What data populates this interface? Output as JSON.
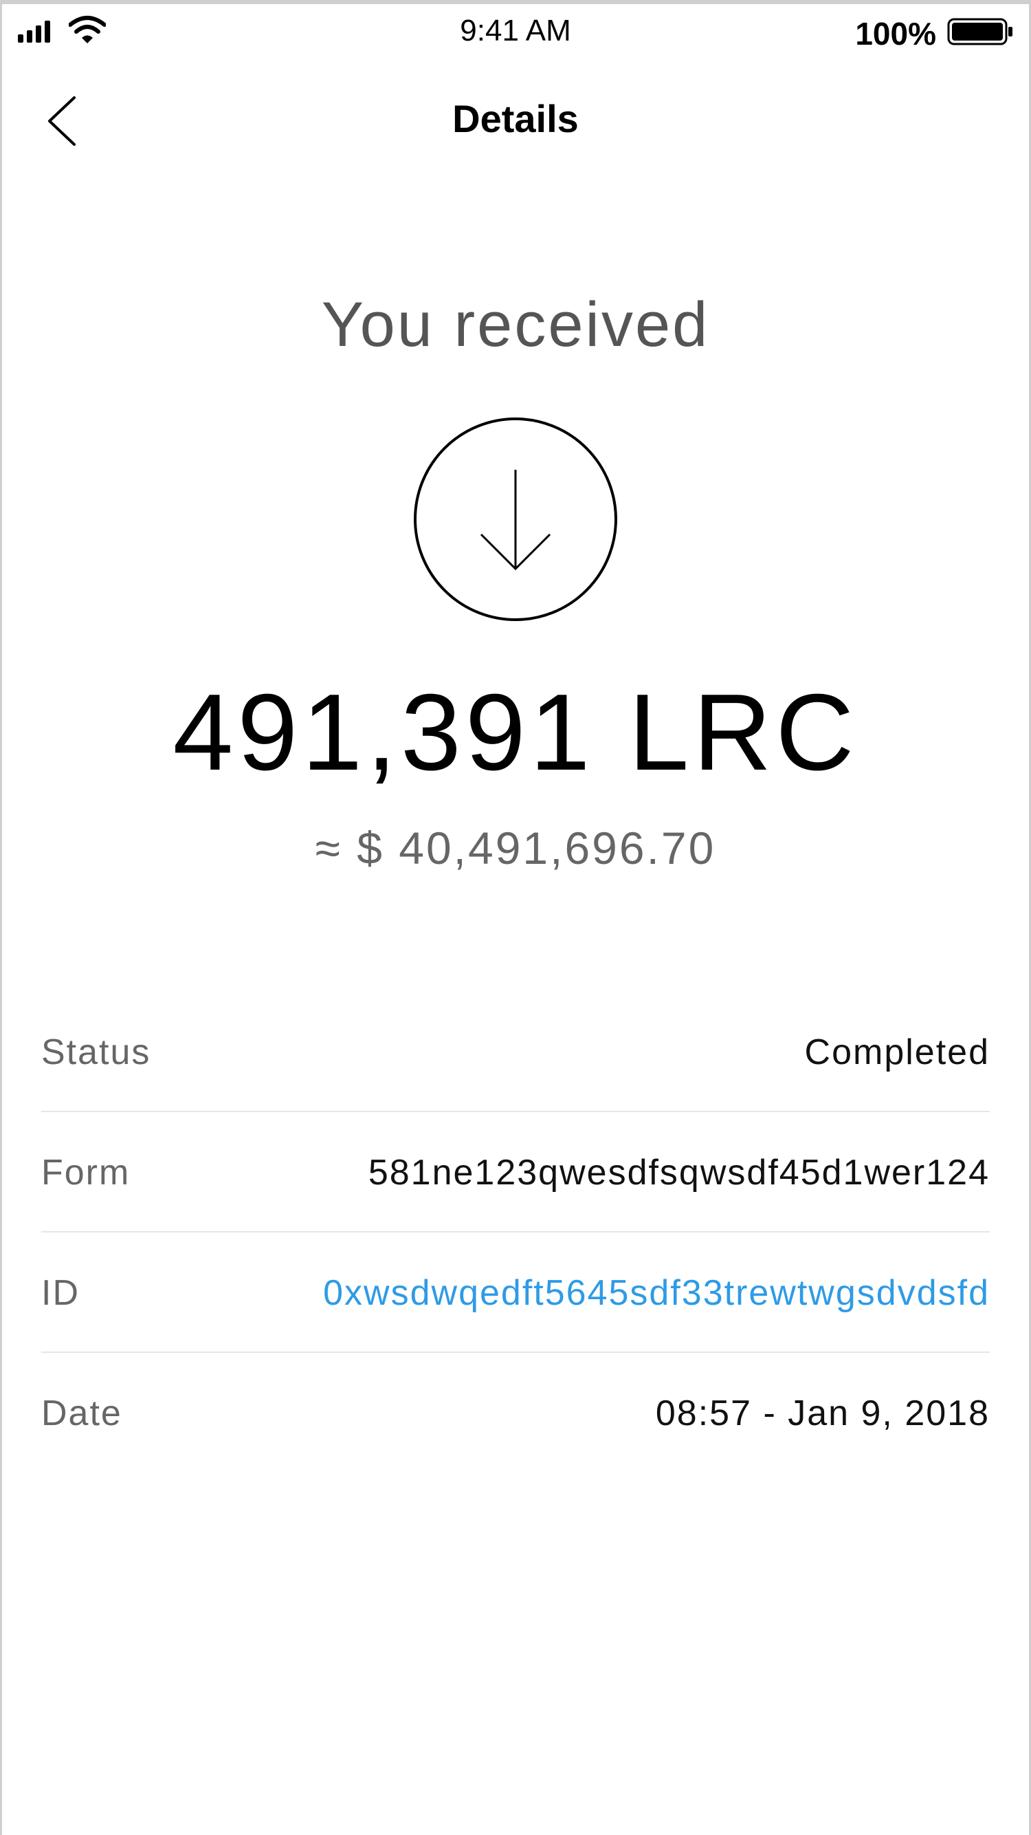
{
  "status_bar": {
    "time": "9:41 AM",
    "battery_percent": "100%",
    "signal_bars": 4,
    "signal_icon": "cellular-signal-icon",
    "wifi_icon": "wifi-icon",
    "battery_icon": "battery-icon"
  },
  "nav": {
    "title": "Details",
    "back_icon": "chevron-left-icon"
  },
  "transaction": {
    "headline": "You received",
    "direction_icon": "arrow-down-circle-icon",
    "amount": "491,391 LRC",
    "fiat_value": "≈ $ 40,491,696.70"
  },
  "details": [
    {
      "label": "Status",
      "value": "Completed"
    },
    {
      "label": "Form",
      "value": "581ne123qwesdfsqwsdf45d1wer124"
    },
    {
      "label": "ID",
      "value": "0xwsdwqedft5645sdf33trewtwgsdvdsfd"
    },
    {
      "label": "Date",
      "value": "08:57 - Jan 9, 2018"
    }
  ],
  "colors": {
    "link": "#2e9be6",
    "label": "#666666",
    "divider": "#e6e6e6"
  }
}
